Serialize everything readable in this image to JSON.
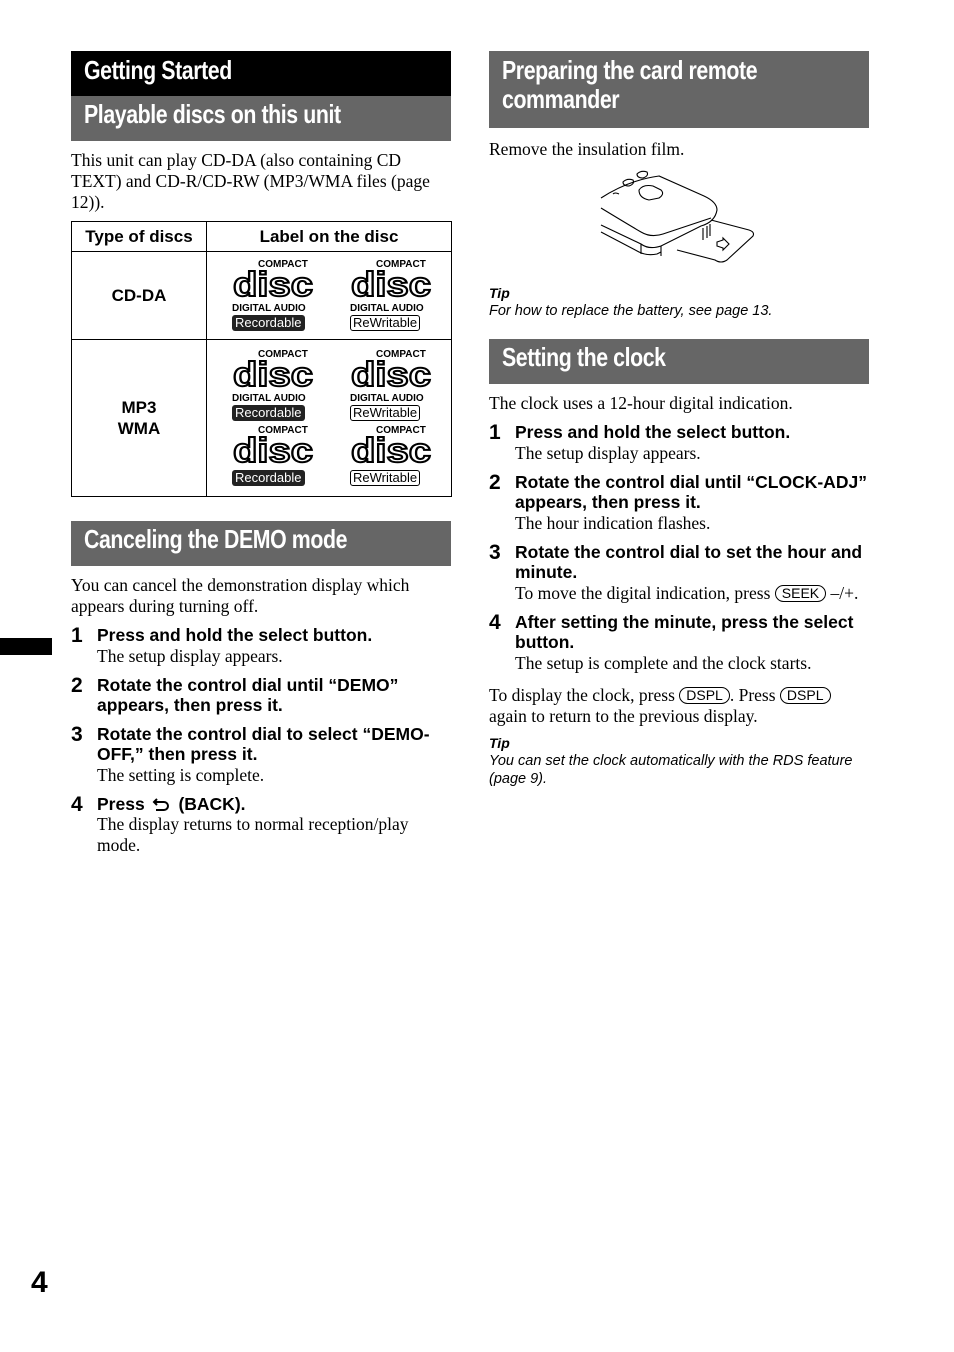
{
  "page_number": "4",
  "left": {
    "chapter_title": "Getting Started",
    "playable": {
      "heading": "Playable discs on this unit",
      "intro": "This unit can play CD-DA (also containing CD TEXT) and CD-R/CD-RW (MP3/WMA files (page 12)).",
      "table": {
        "headers": [
          "Type of discs",
          "Label on the disc"
        ],
        "rows": [
          {
            "type_lines": [
              "CD-DA"
            ],
            "logos": [
              {
                "compact": "COMPACT",
                "disc": "disc",
                "digital_audio": "DIGITAL AUDIO",
                "badge": "Recordable",
                "badge_style": "filled"
              },
              {
                "compact": "COMPACT",
                "disc": "disc",
                "digital_audio": "DIGITAL AUDIO",
                "badge": "ReWritable",
                "badge_style": "outline"
              }
            ]
          },
          {
            "type_lines": [
              "MP3",
              "WMA"
            ],
            "logos": [
              {
                "compact": "COMPACT",
                "disc": "disc",
                "digital_audio": "DIGITAL AUDIO",
                "badge": "Recordable",
                "badge_style": "filled"
              },
              {
                "compact": "COMPACT",
                "disc": "disc",
                "digital_audio": "DIGITAL AUDIO",
                "badge": "ReWritable",
                "badge_style": "outline"
              },
              {
                "compact": "COMPACT",
                "disc": "disc",
                "digital_audio": "",
                "badge": "Recordable",
                "badge_style": "filled"
              },
              {
                "compact": "COMPACT",
                "disc": "disc",
                "digital_audio": "",
                "badge": "ReWritable",
                "badge_style": "outline"
              }
            ]
          }
        ]
      }
    },
    "demo": {
      "heading": "Canceling the DEMO mode",
      "intro": "You can cancel the demonstration display which appears during turning off.",
      "steps": [
        {
          "num": "1",
          "title": "Press and hold the select button.",
          "desc": "The setup display appears."
        },
        {
          "num": "2",
          "title": "Rotate the control dial until “DEMO” appears, then press it.",
          "desc": ""
        },
        {
          "num": "3",
          "title": "Rotate the control dial to select “DEMO-OFF,” then press it.",
          "desc": "The setting is complete."
        },
        {
          "num": "4",
          "title_before": "Press",
          "icon": "back-arrow-icon",
          "title_after": "(BACK).",
          "desc": "The display returns to normal reception/play mode."
        }
      ]
    }
  },
  "right": {
    "remote": {
      "heading": "Preparing the card remote commander",
      "intro": "Remove the insulation film.",
      "illustration": "card-remote-insulation-film-illustration",
      "tip_label": "Tip",
      "tip_text": "For how to replace the battery, see page 13."
    },
    "clock": {
      "heading": "Setting the clock",
      "intro": "The clock uses a 12-hour digital indication.",
      "steps": [
        {
          "num": "1",
          "title": "Press and hold the select button.",
          "desc": "The setup display appears."
        },
        {
          "num": "2",
          "title": "Rotate the control dial until “CLOCK-ADJ” appears, then press it.",
          "desc": "The hour indication flashes."
        },
        {
          "num": "3",
          "title": "Rotate the control dial to set the hour and minute.",
          "desc_before": "To move the digital indication, press",
          "key": "SEEK",
          "desc_after": "–/+."
        },
        {
          "num": "4",
          "title": "After setting the minute, press the select button.",
          "desc": "The setup is complete and the clock starts."
        }
      ],
      "display_note": {
        "part1": "To display the clock, press",
        "key1": "DSPL",
        "part2": ". Press",
        "key2": "DSPL",
        "part3": "again to return to the previous display."
      },
      "tip_label": "Tip",
      "tip_text": "You can set the clock automatically with the RDS feature (page 9)."
    }
  }
}
